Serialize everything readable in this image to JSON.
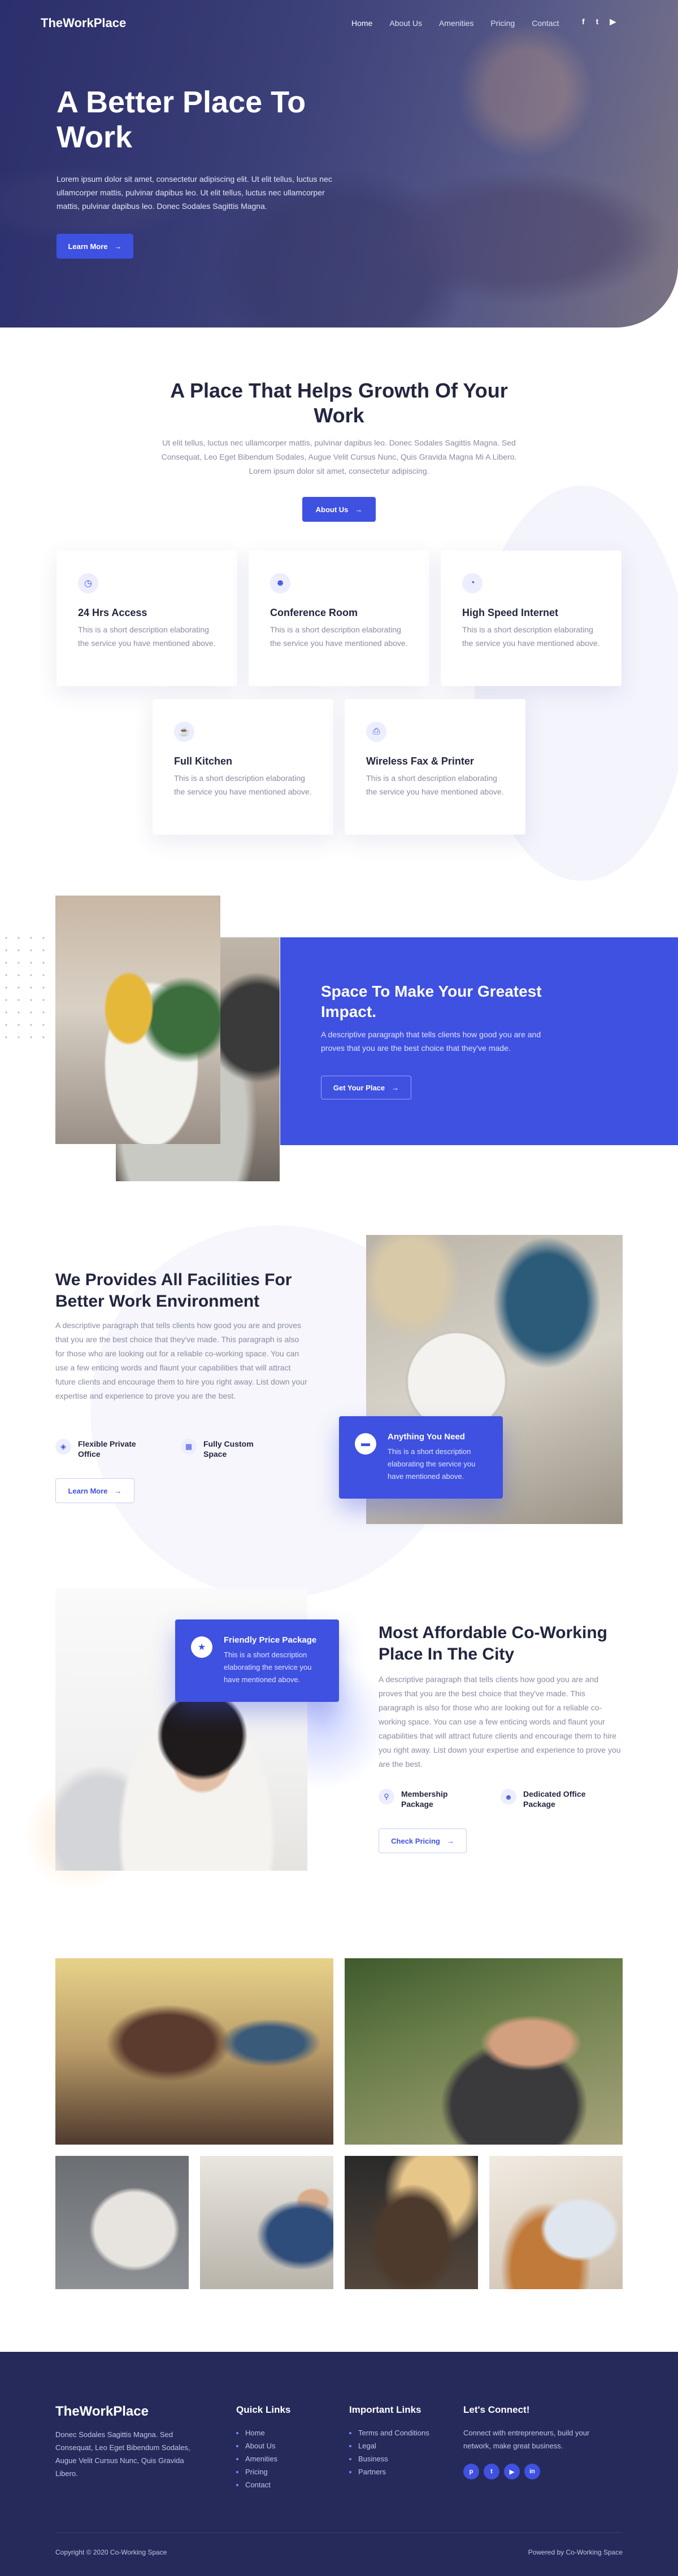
{
  "brand": {
    "logo": "TheWorkPlace",
    "accent": "#3f51e0",
    "navy": "#262a5a"
  },
  "nav": {
    "items": [
      {
        "label": "Home"
      },
      {
        "label": "About Us"
      },
      {
        "label": "Amenities"
      },
      {
        "label": "Pricing"
      },
      {
        "label": "Contact"
      }
    ],
    "social_icons": [
      "facebook-icon",
      "twitter-icon",
      "youtube-icon"
    ],
    "social_glyphs": [
      "f",
      "t",
      "▶"
    ]
  },
  "hero": {
    "title": "A Better Place To Work",
    "text": "Lorem ipsum dolor sit amet, consectetur adipiscing elit. Ut elit tellus, luctus nec ullamcorper mattis, pulvinar dapibus leo. Ut elit tellus, luctus nec ullamcorper mattis, pulvinar dapibus leo. Donec Sodales Sagittis Magna.",
    "button": "Learn More"
  },
  "place": {
    "title": "A Place That Helps Growth Of Your Work",
    "text": "Ut elit tellus, luctus nec ullamcorper mattis, pulvinar dapibus leo. Donec Sodales Sagittis Magna. Sed Consequat, Leo Eget Bibendum Sodales, Augue Velit Cursus Nunc, Quis Gravida Magna Mi A Libero. Lorem ipsum dolor sit amet, consectetur adipiscing.",
    "button": "About Us",
    "cards": [
      {
        "icon": "clock-icon",
        "glyph": "◷",
        "title": "24 Hrs Access",
        "text": "This is a short description elaborating the service you have mentioned above."
      },
      {
        "icon": "users-icon",
        "glyph": "☻",
        "title": "Conference Room",
        "text": "This is a short description elaborating the service you have mentioned above."
      },
      {
        "icon": "speed-gauge-icon",
        "glyph": "◔",
        "title": "High Speed Internet",
        "text": "This is a short description elaborating the service you have mentioned above."
      },
      {
        "icon": "kitchen-icon",
        "glyph": "☕",
        "title": "Full Kitchen",
        "text": "This is a short description elaborating the service you have mentioned above."
      },
      {
        "icon": "printer-icon",
        "glyph": "⎙",
        "title": "Wireless Fax & Printer",
        "text": "This is a short description elaborating the service you have mentioned above."
      }
    ]
  },
  "impact": {
    "title": "Space To Make Your Greatest Impact.",
    "text": "A descriptive paragraph that tells clients how good you are and proves that you are the best choice that they've made.",
    "button": "Get Your Place"
  },
  "facilities": {
    "title": "We Provides All Facilities For Better Work Environment",
    "text": "A descriptive paragraph that tells clients how good you are and proves that you are the best choice that they've made. This paragraph is also for those who are looking out for a reliable co-working space. You can use a few enticing words and flaunt your capabilities that will attract future clients and encourage them to hire you right away. List down your expertise and experience to prove you are the best.",
    "features": [
      {
        "icon": "cube-icon",
        "glyph": "◈",
        "label": "Flexible Private Office"
      },
      {
        "icon": "building-icon",
        "glyph": "▦",
        "label": "Fully Custom Space"
      }
    ],
    "button": "Learn More",
    "card": {
      "icon": "sofa-icon",
      "glyph": "▬",
      "title": "Anything You Need",
      "text": "This is a short description elaborating the service you have mentioned above."
    }
  },
  "affordable": {
    "title": "Most Affordable Co-Working Place In The City",
    "text": "A descriptive paragraph that tells clients how good you are and proves that you are the best choice that they've made. This paragraph is also for those who are looking out for a reliable co-working space. You can use a few enticing words and flaunt your capabilities that will attract future clients and encourage them to hire you right away. List down your expertise and experience to prove you are the best.",
    "features": [
      {
        "icon": "pin-icon",
        "glyph": "⚲",
        "label": "Membership Package"
      },
      {
        "icon": "team-icon",
        "glyph": "☻",
        "label": "Dedicated Office Package"
      }
    ],
    "button": "Check Pricing",
    "card": {
      "icon": "star-badge-icon",
      "glyph": "★",
      "title": "Friendly Price Package",
      "text": "This is a short description elaborating the service you have mentioned above."
    }
  },
  "footer": {
    "logo": "TheWorkPlace",
    "description": "Donec Sodales Sagittis Magna. Sed Consequat, Leo Eget Bibendum Sodales, Augue Velit Cursus Nunc, Quis Gravida Libero.",
    "quick_links_title": "Quick Links",
    "quick_links": [
      "Home",
      "About Us",
      "Amenities",
      "Pricing",
      "Contact"
    ],
    "important_title": "Important Links",
    "important_links": [
      "Terms and Conditions",
      "Legal",
      "Business",
      "Partners"
    ],
    "connect_title": "Let's Connect!",
    "connect_text": "Connect with entrepreneurs, build your network, make great business.",
    "socials": [
      {
        "icon": "pinterest-icon",
        "glyph": "p"
      },
      {
        "icon": "twitter-icon",
        "glyph": "t"
      },
      {
        "icon": "youtube-icon",
        "glyph": "▶"
      },
      {
        "icon": "linkedin-icon",
        "glyph": "in"
      }
    ],
    "copyright": "Copyright © 2020 Co-Working Space",
    "powered": "Powered by Co-Working Space"
  }
}
